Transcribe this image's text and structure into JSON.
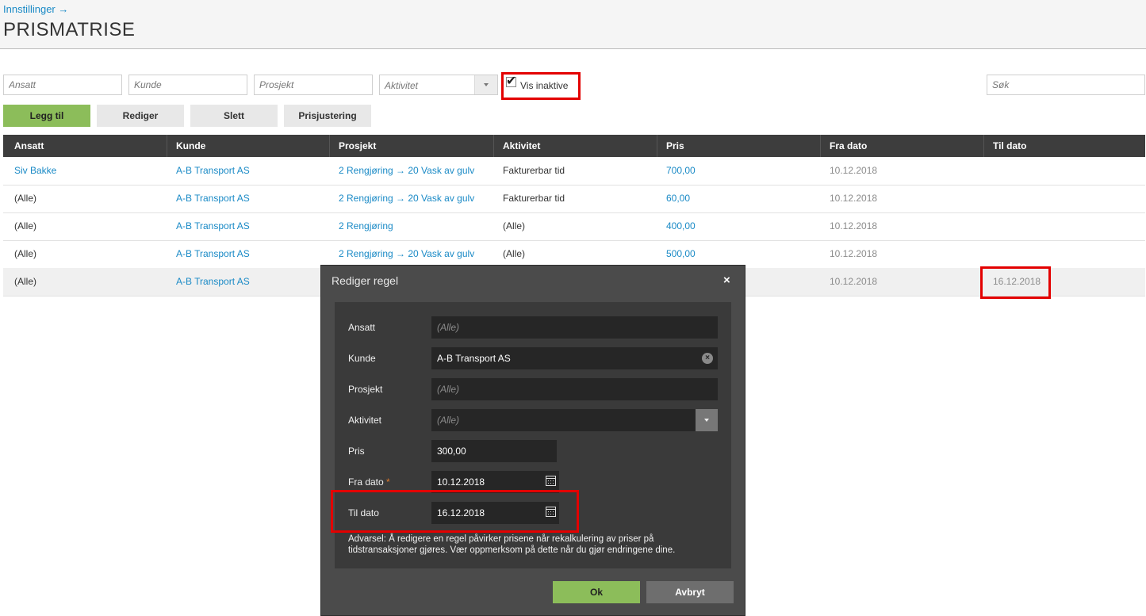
{
  "header": {
    "breadcrumb": "Innstillinger →",
    "title": "PRISMATRISE"
  },
  "filters": {
    "ansatt_placeholder": "Ansatt",
    "kunde_placeholder": "Kunde",
    "prosjekt_placeholder": "Prosjekt",
    "aktivitet_placeholder": "Aktivitet",
    "vis_inaktive_label": "Vis inaktive",
    "vis_inaktive_checked": true,
    "search_placeholder": "Søk"
  },
  "toolbar": {
    "add": "Legg til",
    "edit": "Rediger",
    "delete": "Slett",
    "adjust": "Prisjustering"
  },
  "table": {
    "columns": [
      "Ansatt",
      "Kunde",
      "Prosjekt",
      "Aktivitet",
      "Pris",
      "Fra dato",
      "Til dato"
    ],
    "rows": [
      [
        "Siv Bakke",
        "A-B Transport AS",
        "2 Rengjøring → 20 Vask av gulv",
        "Fakturerbar tid",
        "700,00",
        "10.12.2018",
        ""
      ],
      [
        "(Alle)",
        "A-B Transport AS",
        "2 Rengjøring → 20 Vask av gulv",
        "Fakturerbar tid",
        "60,00",
        "10.12.2018",
        ""
      ],
      [
        "(Alle)",
        "A-B Transport AS",
        "2 Rengjøring",
        "(Alle)",
        "400,00",
        "10.12.2018",
        ""
      ],
      [
        "(Alle)",
        "A-B Transport AS",
        "2 Rengjøring → 20 Vask av gulv",
        "(Alle)",
        "500,00",
        "10.12.2018",
        ""
      ],
      [
        "(Alle)",
        "A-B Transport AS",
        "",
        "",
        "",
        "10.12.2018",
        "16.12.2018"
      ]
    ]
  },
  "dialog": {
    "title": "Rediger regel",
    "close": "×",
    "labels": {
      "ansatt": "Ansatt",
      "kunde": "Kunde",
      "prosjekt": "Prosjekt",
      "aktivitet": "Aktivitet",
      "pris": "Pris",
      "fra_dato": "Fra dato",
      "til_dato": "Til dato"
    },
    "required_marker": "*",
    "values": {
      "ansatt": "(Alle)",
      "kunde": "A-B Transport AS",
      "prosjekt": "(Alle)",
      "aktivitet": "(Alle)",
      "pris": "300,00",
      "fra_dato": "10.12.2018",
      "til_dato": "16.12.2018"
    },
    "warning": "Advarsel: Å redigere en regel påvirker prisene når rekalkulering av priser på tidstransaksjoner gjøres. Vær oppmerksom på dette når du gjør endringene dine.",
    "ok": "Ok",
    "cancel": "Avbryt"
  },
  "colors": {
    "accent_link": "#1a8ac6",
    "primary_button": "#8cbd5a",
    "header_dark": "#3d3d3d",
    "highlight": "#e30000"
  }
}
